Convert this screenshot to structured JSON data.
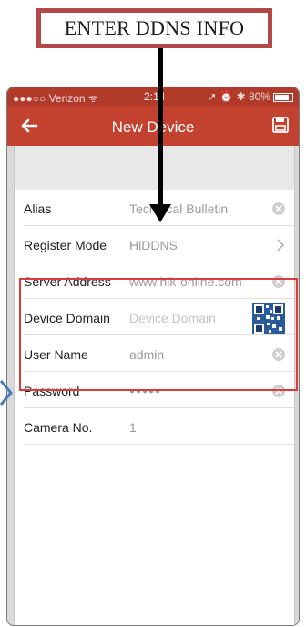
{
  "callout": {
    "text": "ENTER DDNS INFO"
  },
  "status_bar": {
    "carrier": "●●●○○ Verizon ᯤ",
    "time": "2:14",
    "indicators": "➚ ⏰ ✱ 80%"
  },
  "navbar": {
    "title": "New Device",
    "back_icon": "back-arrow-icon",
    "save_icon": "save-icon"
  },
  "form": {
    "rows": [
      {
        "label": "Alias",
        "value": "Technical Bulletin",
        "accessory": "clear-icon"
      },
      {
        "label": "Register Mode",
        "value": "HiDDNS",
        "accessory": "chevron-right-icon"
      },
      {
        "label": "Server Address",
        "value": "www.hik-online.com",
        "accessory": "clear-icon"
      },
      {
        "label": "Device Domain",
        "placeholder": "Device Domain",
        "accessory": "qr-code-icon"
      },
      {
        "label": "User Name",
        "value": "admin",
        "accessory": "clear-icon"
      },
      {
        "label": "Password",
        "value": "●●●●●",
        "accessory": "clear-icon"
      },
      {
        "label": "Camera No.",
        "value": "1"
      }
    ]
  },
  "colors": {
    "navbar": "#c2412f",
    "highlight": "#d93c3c",
    "callout_border": "#b34848",
    "side_arrow": "#4a7ab8"
  }
}
